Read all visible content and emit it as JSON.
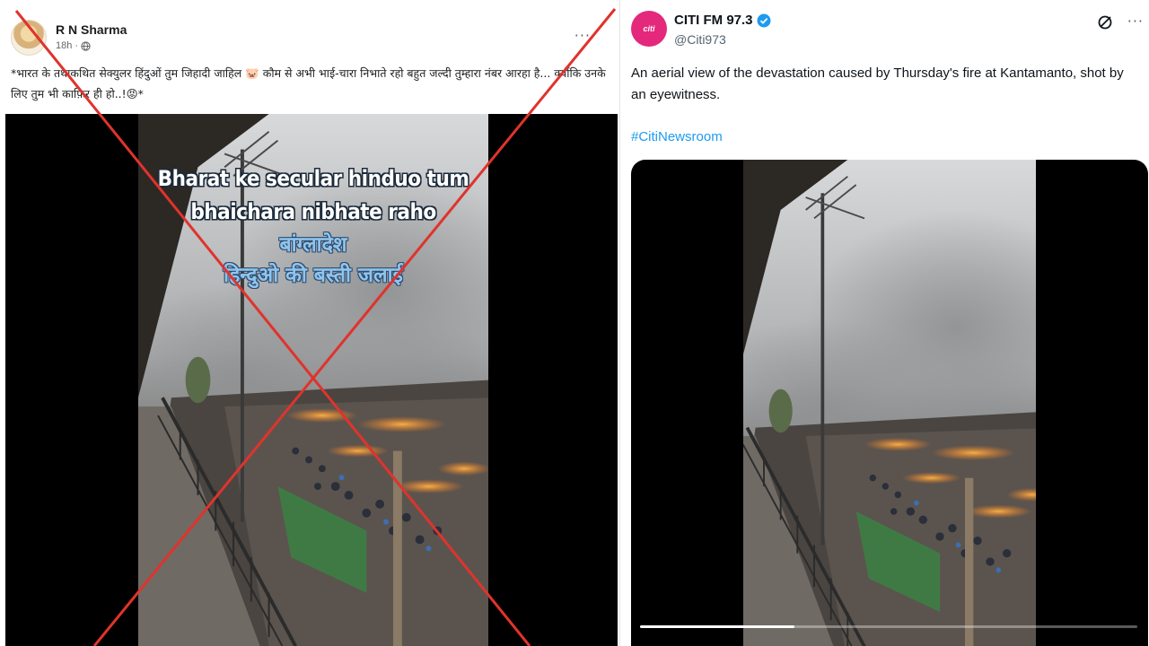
{
  "facebook_post": {
    "author": "R N Sharma",
    "time": "18h",
    "caption": "*भारत के तथाकथित सेक्युलर हिंदुओं तुम जिहादी जाहिल 🐷 कौम से अभी भाई-चारा निभाते रहो बहुत जल्दी तुम्हारा नंबर आरहा है... क्योंकि उनके लिए तुम भी काफ़िर ही हो..!😡*",
    "video_overlay": {
      "line1": "Bharat ke secular hinduo tum",
      "line2": "bhaichara nibhate raho",
      "line3": "बांग्लादेश",
      "line4": "हिन्दुओ की बस्ती जलाई"
    }
  },
  "x_post": {
    "account_name": "CITI FM 97.3",
    "handle": "@Citi973",
    "avatar_text": "citi",
    "text": "An aerial view of the devastation caused by Thursday's fire at Kantamanto, shot by an eyewitness.",
    "hashtag": "#CitiNewsroom",
    "video_progress": 0.31
  },
  "colors": {
    "cross": "#e0332c",
    "x_blue": "#1d9bf0",
    "citi_pink": "#e4287c"
  },
  "icons": {
    "fb_privacy": "globe-icon",
    "fb_menu": "ellipsis-icon",
    "x_verified": "verified-badge-icon",
    "x_grok": "grok-icon",
    "x_menu": "ellipsis-icon"
  }
}
